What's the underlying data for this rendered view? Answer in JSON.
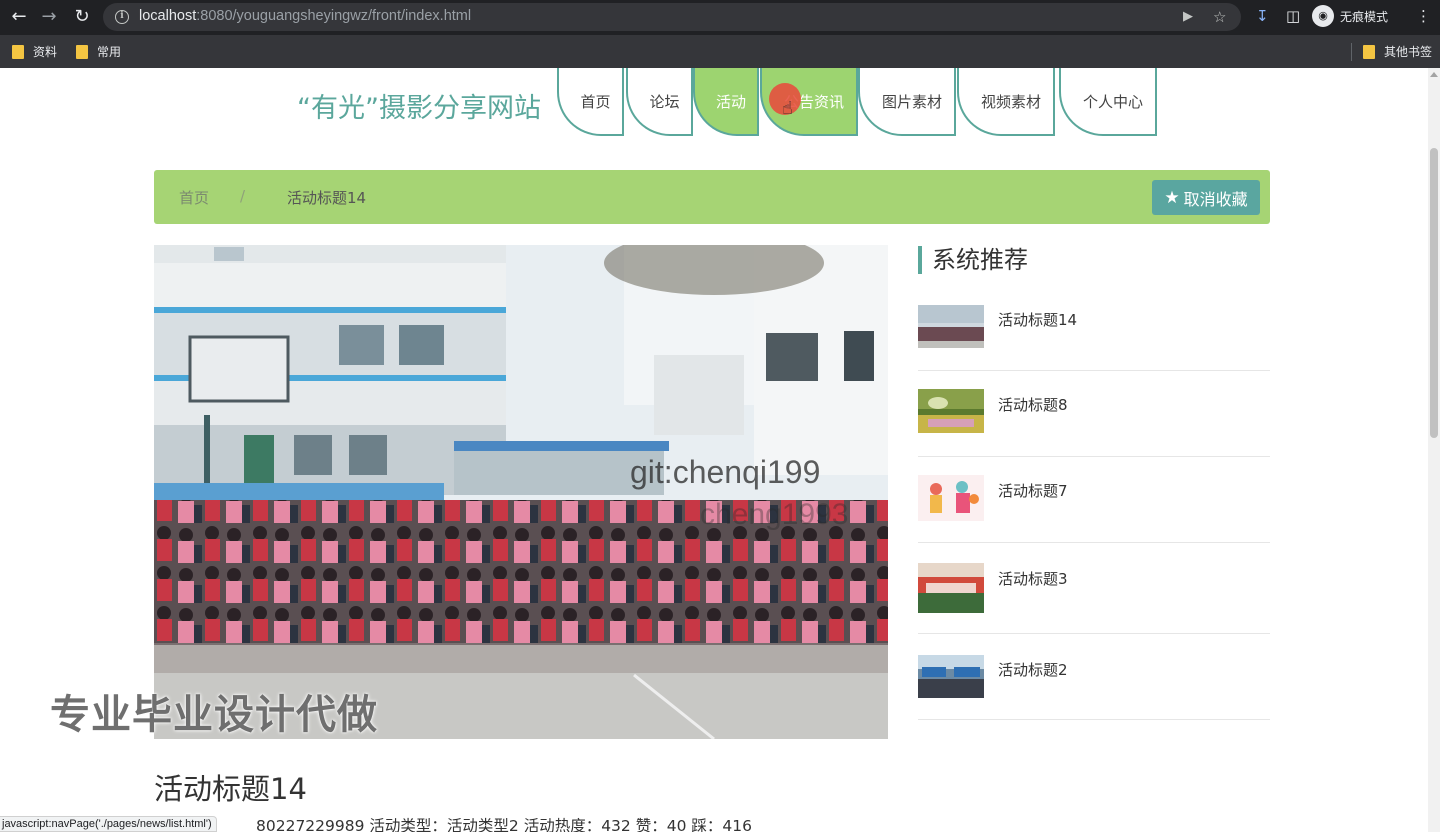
{
  "browser": {
    "url_host": "localhost",
    "url_rest": ":8080/youguangsheyingwz/front/index.html",
    "incognito_label": "无痕模式",
    "bookmarks": [
      "资料",
      "常用"
    ],
    "other_bookmarks": "其他书签",
    "status_text": "javascript:navPage('./pages/news/list.html')"
  },
  "site": {
    "title": "“有光”摄影分享网站",
    "nav": [
      "首页",
      "论坛",
      "活动",
      "公告资讯",
      "图片素材",
      "视频素材",
      "个人中心"
    ],
    "active_nav": "活动",
    "accent_color": "#9dd470",
    "theme_color": "#5aa79b"
  },
  "breadcrumb": {
    "home": "首页",
    "separator": "/",
    "current": "活动标题14"
  },
  "favorite_button": "取消收藏",
  "sidebar": {
    "title": "系统推荐",
    "items": [
      {
        "label": "活动标题14"
      },
      {
        "label": "活动标题8"
      },
      {
        "label": "活动标题7"
      },
      {
        "label": "活动标题3"
      },
      {
        "label": "活动标题2"
      }
    ]
  },
  "article": {
    "title": "活动标题14",
    "meta": "80227229989   活动类型：活动类型2   活动热度：432   赞：40   踩：416"
  },
  "watermarks": {
    "git": "git:chenqi199",
    "ghost": "cheng1993",
    "promo": "专业毕业设计代做"
  }
}
